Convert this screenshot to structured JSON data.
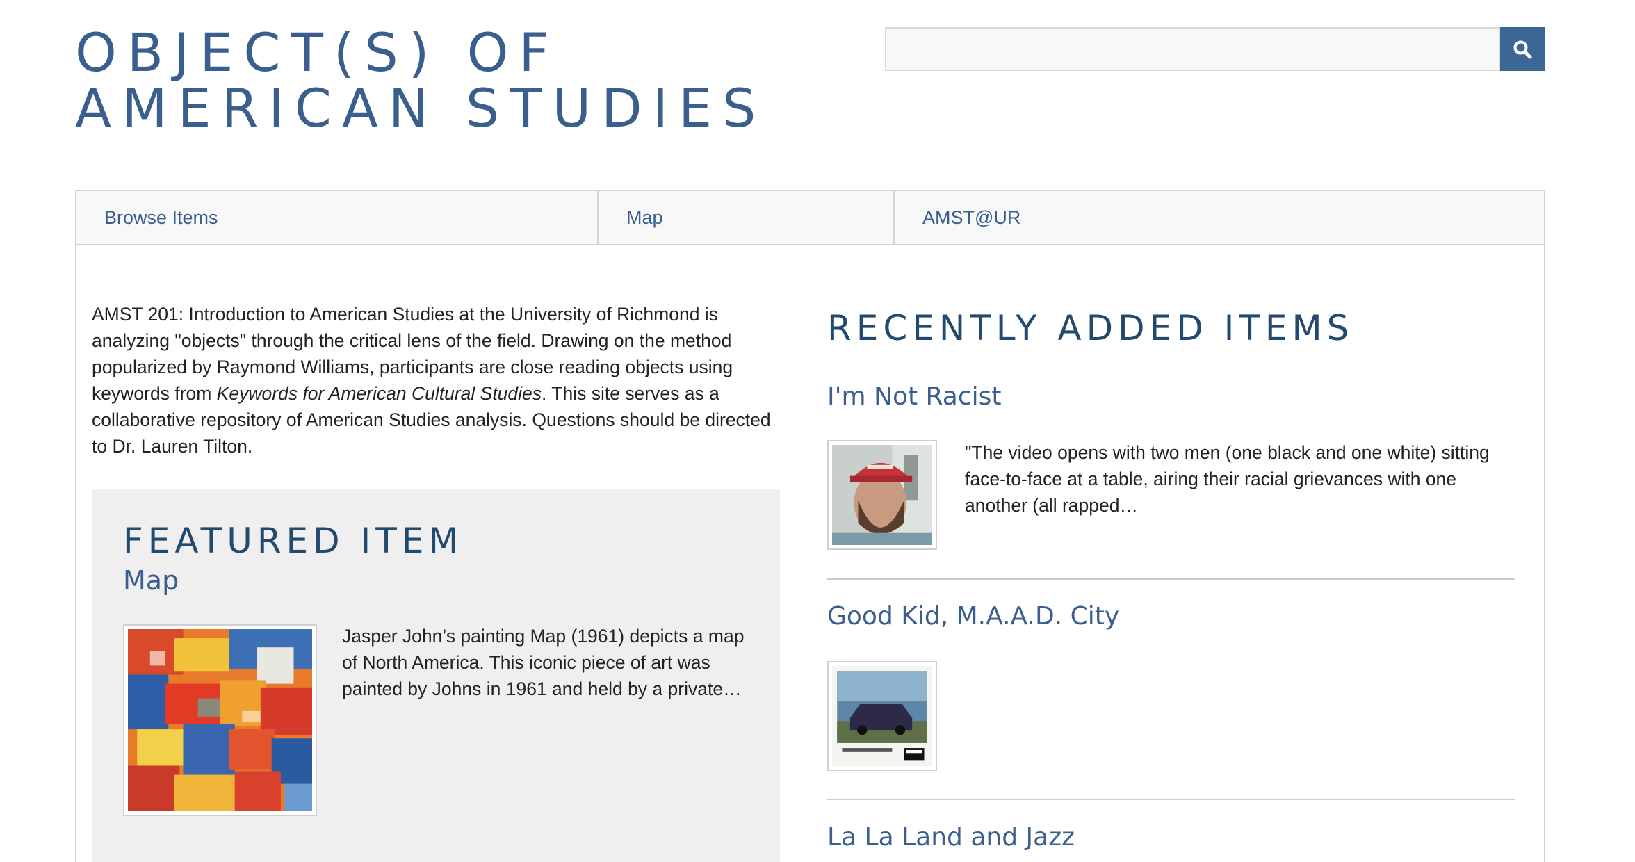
{
  "site": {
    "title_line1": "OBJECT(S) OF",
    "title_line2": "AMERICAN STUDIES"
  },
  "search": {
    "value": "",
    "placeholder": "",
    "icon": "search-icon"
  },
  "nav": {
    "items": [
      {
        "label": "Browse Items"
      },
      {
        "label": "Map"
      },
      {
        "label": "AMST@UR"
      }
    ]
  },
  "intro": {
    "part1": "AMST 201: Introduction to American Studies at the University of Richmond is analyzing \"objects\" through the critical lens of the field. Drawing on the method popularized by Raymond Williams, participants are close reading objects using keywords from ",
    "book_title": "Keywords for American Cultural Studies",
    "part2": ". This site serves as a collaborative repository of American Studies analysis. Questions should be directed to Dr. Lauren Tilton."
  },
  "featured": {
    "heading": "FEATURED ITEM",
    "item_title": "Map",
    "description": "Jasper John’s painting Map (1961) depicts a map of North America. This iconic piece of art was painted by Johns in 1961 and held by a private…"
  },
  "recent": {
    "heading": "RECENTLY ADDED ITEMS",
    "items": [
      {
        "title": "I'm Not Racist",
        "description": "\"The video opens with two men (one black and one white) sitting face-to-face at a table, airing their racial grievances with one another (all rapped…"
      },
      {
        "title": "Good Kid, M.A.A.D. City",
        "description": ""
      },
      {
        "title": "La La Land and Jazz",
        "description": ""
      }
    ]
  },
  "colors": {
    "brand": "#3a5f8f",
    "heading": "#23496f",
    "search_button": "#3a6796",
    "nav_background": "#f8f8f8",
    "featured_background": "#efefef"
  }
}
